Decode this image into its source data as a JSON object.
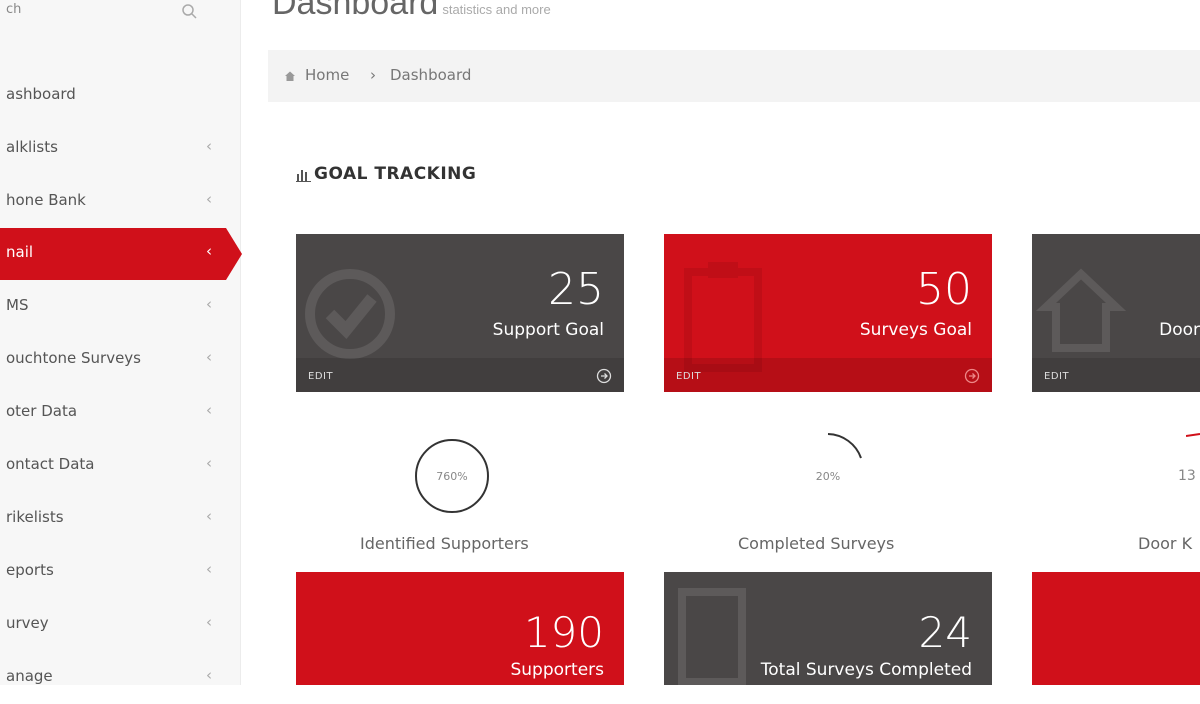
{
  "sidebar": {
    "search_label": "ch",
    "items": [
      {
        "label": "ashboard",
        "chevron": ""
      },
      {
        "label": "alklists",
        "chevron": "‹"
      },
      {
        "label": "hone Bank",
        "chevron": "‹"
      },
      {
        "label": "nail",
        "chevron": "‹"
      },
      {
        "label": "MS",
        "chevron": "‹"
      },
      {
        "label": "ouchtone Surveys",
        "chevron": "‹"
      },
      {
        "label": "oter Data",
        "chevron": "‹"
      },
      {
        "label": "ontact Data",
        "chevron": "‹"
      },
      {
        "label": "rikelists",
        "chevron": "‹"
      },
      {
        "label": "eports",
        "chevron": "‹"
      },
      {
        "label": "urvey",
        "chevron": "‹"
      },
      {
        "label": "anage",
        "chevron": "‹"
      }
    ],
    "active_index": 3
  },
  "header": {
    "title": "Dashboard",
    "subtitle": "statistics and more"
  },
  "breadcrumb": {
    "home": "Home",
    "separator": "›",
    "current": "Dashboard"
  },
  "goal_tracking": {
    "title": "GOAL TRACKING",
    "tiles": [
      {
        "value": "25",
        "label": "Support Goal",
        "edit": "EDIT",
        "color": "#4a4747",
        "icon": "check-circle-icon"
      },
      {
        "value": "50",
        "label": "Surveys Goal",
        "edit": "EDIT",
        "color": "#d0101a",
        "icon": "clipboard-icon"
      },
      {
        "value": "",
        "label": "Door",
        "edit": "EDIT",
        "color": "#4a4747",
        "icon": "house-icon"
      }
    ],
    "progress": [
      {
        "percent_text": "760%",
        "percent": 760,
        "label": "Identified Supporters"
      },
      {
        "percent_text": "20%",
        "percent": 20,
        "label": "Completed Surveys"
      },
      {
        "percent_text": "13",
        "percent": 13,
        "label": "Door K"
      }
    ],
    "bottom_tiles": [
      {
        "value": "190",
        "label": "Supporters",
        "color": "#d0101a"
      },
      {
        "value": "24",
        "label": "Total Surveys Completed",
        "color": "#4a4747"
      },
      {
        "value": "",
        "label": "",
        "color": "#d0101a"
      }
    ]
  },
  "colors": {
    "accent": "#d0101a",
    "tile_gray": "#4a4747"
  }
}
